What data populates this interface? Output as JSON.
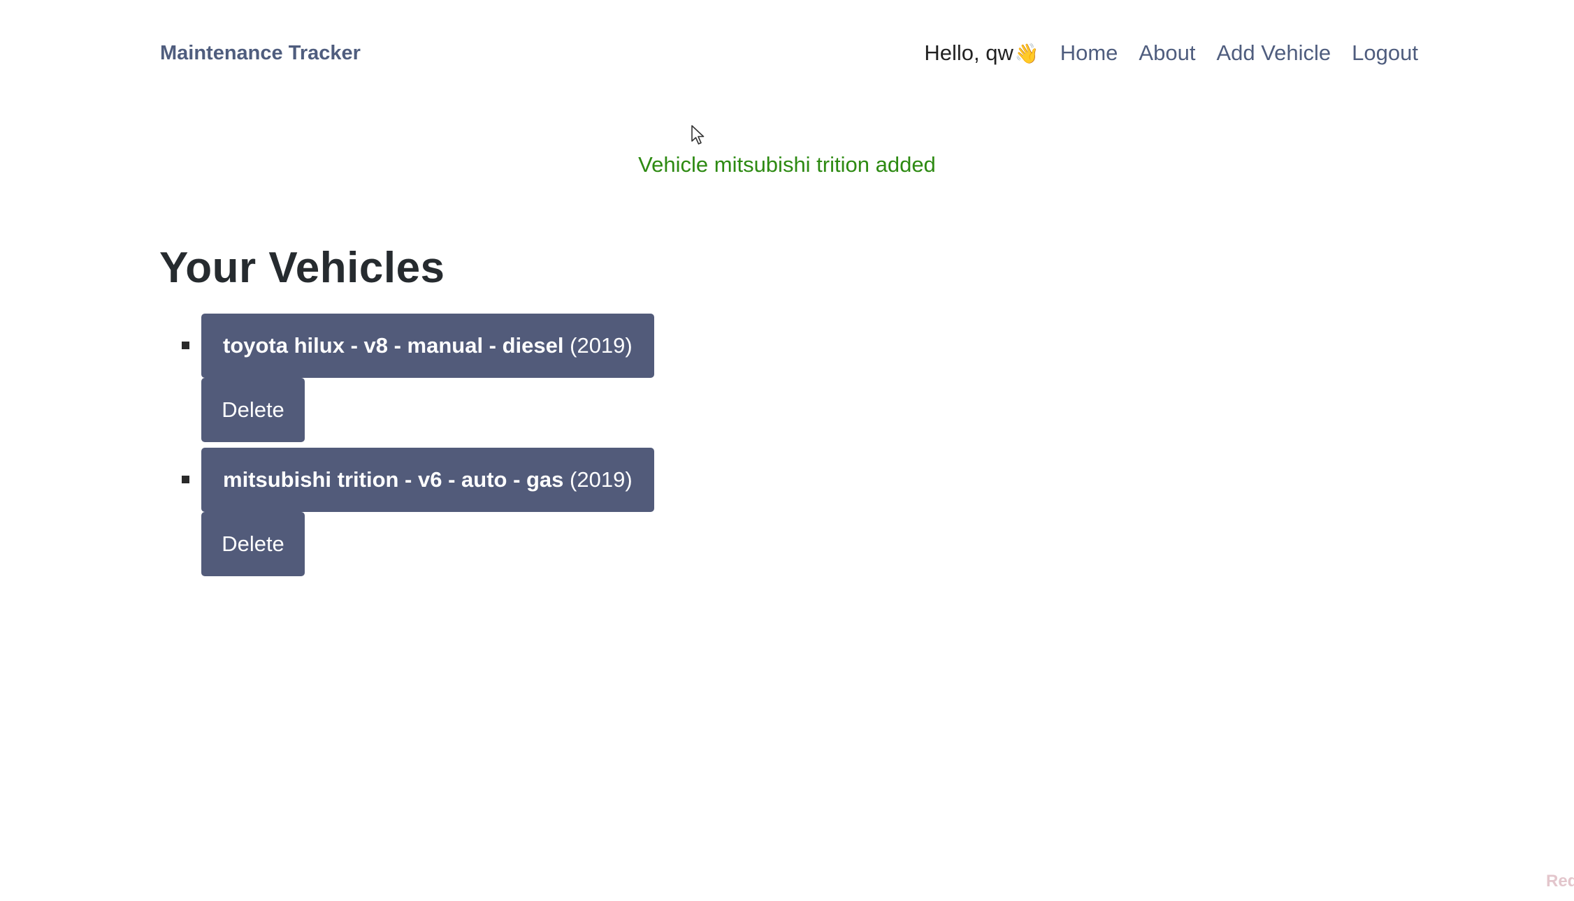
{
  "header": {
    "brand": "Maintenance Tracker",
    "greeting": "Hello, qw",
    "greeting_emoji": "👋",
    "links": {
      "home": "Home",
      "about": "About",
      "add_vehicle": "Add Vehicle",
      "logout": "Logout"
    }
  },
  "flash": {
    "message": "Vehicle mitsubishi trition added",
    "color": "#2d8a12"
  },
  "main": {
    "title": "Your Vehicles",
    "vehicles": [
      {
        "name": "toyota hilux - v8 - manual - diesel",
        "year": "(2019)",
        "delete_label": "Delete"
      },
      {
        "name": "mitsubishi trition - v6 - auto - gas",
        "year": "(2019)",
        "delete_label": "Delete"
      }
    ]
  },
  "footer": {
    "corner_text": "Req"
  },
  "theme": {
    "accent": "#525b7a",
    "brand_color": "#4f5d7e"
  }
}
